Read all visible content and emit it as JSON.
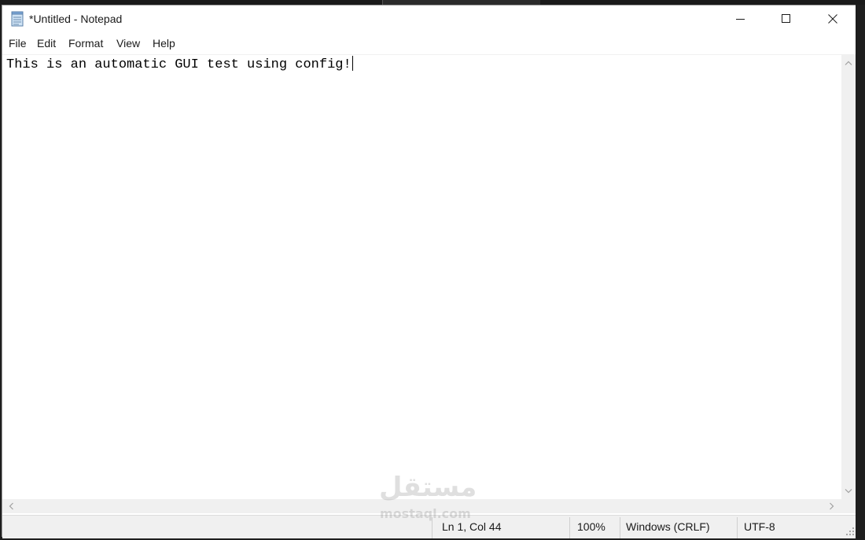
{
  "window": {
    "title": "*Untitled - Notepad"
  },
  "menu": {
    "items": [
      "File",
      "Edit",
      "Format",
      "View",
      "Help"
    ]
  },
  "editor": {
    "content": "This is an automatic GUI test using config!"
  },
  "status": {
    "position": "Ln 1, Col 44",
    "zoom": "100%",
    "line_ending": "Windows (CRLF)",
    "encoding": "UTF-8"
  },
  "watermark": {
    "logo": "مستقل",
    "domain": "mostaql.com"
  },
  "icons": {
    "app": "notepad-icon",
    "minimize": "minimize-icon",
    "maximize": "maximize-icon",
    "close": "close-icon"
  },
  "colors": {
    "window_bg": "#ffffff",
    "chrome_bg": "#f0f0f0",
    "text": "#1a1a1a"
  }
}
